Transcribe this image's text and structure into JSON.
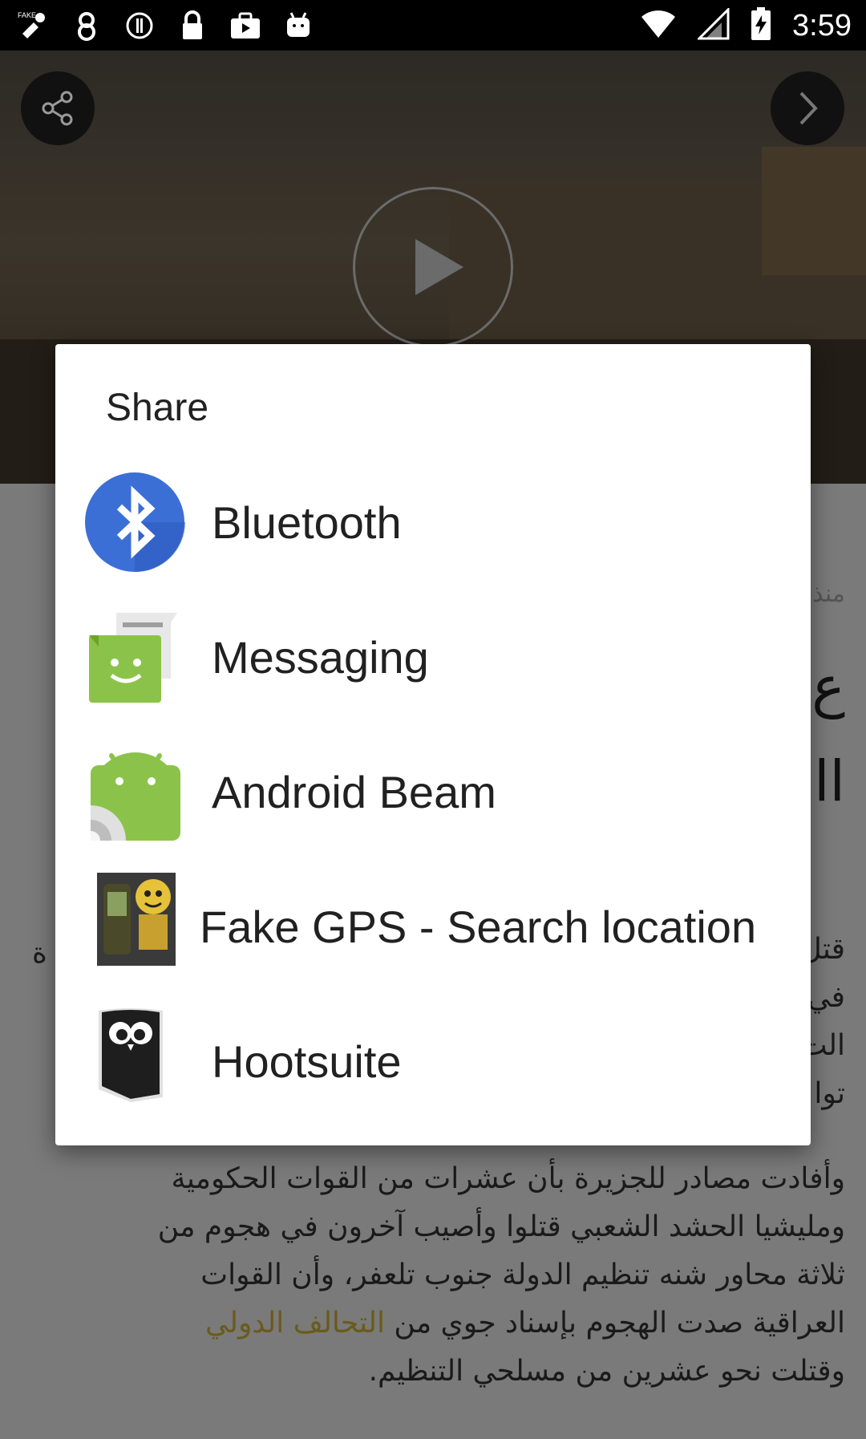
{
  "status_bar": {
    "time": "3:59",
    "left_icons": [
      "fake-gps-icon",
      "notification-icon",
      "info-icon",
      "lock-icon",
      "briefcase-icon",
      "play-store-icon",
      "android-icon"
    ],
    "right_icons": [
      "wifi-icon",
      "signal-icon",
      "battery-charging-icon"
    ]
  },
  "background": {
    "article_lines": [
      "وأفادت مصادر للجزيرة بأن عشرات من القوات الحكومية",
      "ومليشيا الحشد الشعبي قتلوا وأصيب آخرون في هجوم من",
      "ثلاثة محاور شنه تنظيم الدولة جنوب تلعفر، وأن القوات",
      "العراقية صدت الهجوم بإسناد جوي من",
      "وقتلت نحو عشرين من مسلحي التنظيم."
    ],
    "article_highlight": "التحالف الدولي",
    "side_fragments": [
      "منذ",
      "قتل",
      "في",
      "الت",
      "توا",
      "ة"
    ]
  },
  "dialog": {
    "title": "Share",
    "items": [
      {
        "label": "Bluetooth",
        "icon": "bluetooth-icon"
      },
      {
        "label": "Messaging",
        "icon": "messaging-icon"
      },
      {
        "label": "Android Beam",
        "icon": "android-beam-icon"
      },
      {
        "label": "Fake GPS - Search location",
        "icon": "fake-gps-app-icon"
      },
      {
        "label": "Hootsuite",
        "icon": "hootsuite-icon"
      }
    ]
  },
  "colors": {
    "bluetooth": "#3b6fd6",
    "messaging_green": "#8bc34a",
    "android_green": "#8bc34a",
    "highlight_text": "#6b5a1a"
  }
}
